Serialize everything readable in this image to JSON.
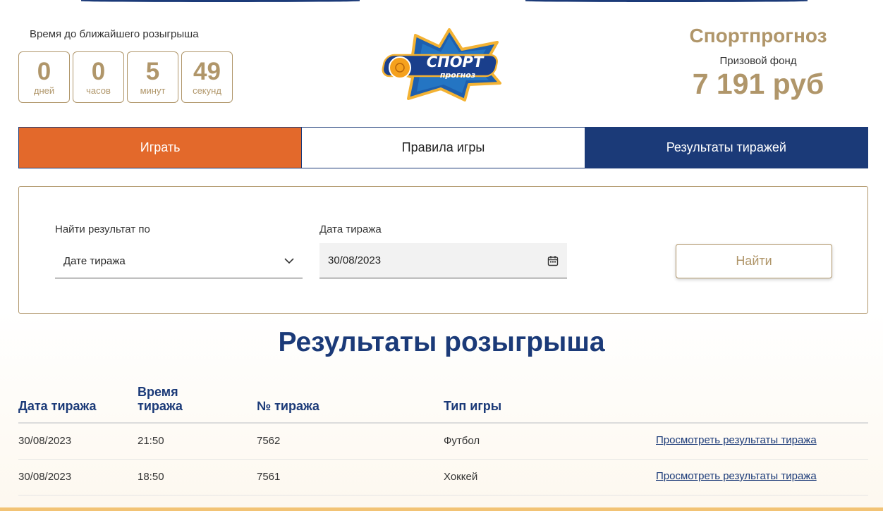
{
  "countdown": {
    "title": "Время до ближайшего розыгрыша",
    "units": [
      {
        "value": "0",
        "label": "дней"
      },
      {
        "value": "0",
        "label": "часов"
      },
      {
        "value": "5",
        "label": "минут"
      },
      {
        "value": "49",
        "label": "секунд"
      }
    ]
  },
  "logo": {
    "line1": "СПОРТ",
    "line2": "прогноз"
  },
  "prize": {
    "title": "Спортпрогноз",
    "label": "Призовой фонд",
    "value": "7 191 руб"
  },
  "tabs": [
    {
      "label": "Играть",
      "state": "accent"
    },
    {
      "label": "Правила игры",
      "state": "default"
    },
    {
      "label": "Результаты тиражей",
      "state": "active"
    }
  ],
  "search": {
    "criteria_label": "Найти результат по",
    "criteria_value": "Дате тиража",
    "date_label": "Дата тиража",
    "date_value": "30/08/2023",
    "button_label": "Найти"
  },
  "results": {
    "title": "Результаты розыгрыша",
    "columns": [
      "Дата тиража",
      "Время тиража",
      "№ тиража",
      "Тип игры"
    ],
    "rows": [
      {
        "date": "30/08/2023",
        "time": "21:50",
        "number": "7562",
        "type": "Футбол",
        "link": "Просмотреть результаты тиража"
      },
      {
        "date": "30/08/2023",
        "time": "18:50",
        "number": "7561",
        "type": "Хоккей",
        "link": "Просмотреть результаты тиража"
      }
    ]
  },
  "colors": {
    "accent": "#e3692b",
    "navy": "#1b3a78",
    "gold": "#b0966a"
  }
}
